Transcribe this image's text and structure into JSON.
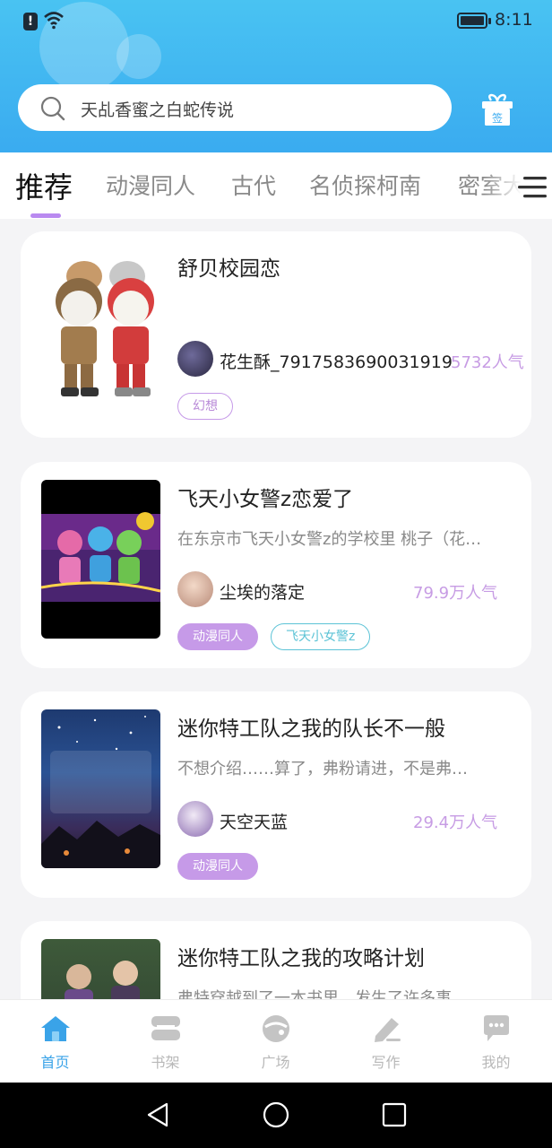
{
  "status_bar": {
    "time": "8:11"
  },
  "search": {
    "placeholder": "天乩香蜜之白蛇传说"
  },
  "gift": {
    "label": "签"
  },
  "tabs": [
    "推荐",
    "动漫同人",
    "古代",
    "名侦探柯南",
    "密室大"
  ],
  "books": [
    {
      "title": "舒贝校园恋",
      "description": "",
      "author": "花生酥_7917583690031919",
      "popularity": "5732人气",
      "tags": [
        {
          "label": "幻想",
          "style": "outline-purple"
        }
      ]
    },
    {
      "title": "飞天小女警z恋爱了",
      "description": "在东京市飞天小女警z的学校里 桃子（花…",
      "author": "尘埃的落定",
      "popularity": "79.9万人气",
      "tags": [
        {
          "label": "动漫同人",
          "style": "filled"
        },
        {
          "label": "飞天小女警z",
          "style": "outline-teal"
        }
      ]
    },
    {
      "title": "迷你特工队之我的队长不一般",
      "description": "不想介绍……算了，弗粉请进，不是弗…",
      "author": "天空天蓝",
      "popularity": "29.4万人气",
      "tags": [
        {
          "label": "动漫同人",
          "style": "filled"
        }
      ]
    },
    {
      "title": "迷你特工队之我的攻略计划",
      "description": "弗特穿越到了一本书里，发生了许多事",
      "author": "",
      "popularity": "",
      "tags": []
    }
  ],
  "bottom_nav": [
    {
      "label": "首页",
      "icon": "home-icon",
      "active": true
    },
    {
      "label": "书架",
      "icon": "bookshelf-icon",
      "active": false
    },
    {
      "label": "广场",
      "icon": "plaza-icon",
      "active": false
    },
    {
      "label": "写作",
      "icon": "write-icon",
      "active": false
    },
    {
      "label": "我的",
      "icon": "profile-icon",
      "active": false
    }
  ],
  "colors": {
    "header": "#3aabf0",
    "accent": "#c69ae8",
    "nav_active": "#3aa3e8"
  }
}
